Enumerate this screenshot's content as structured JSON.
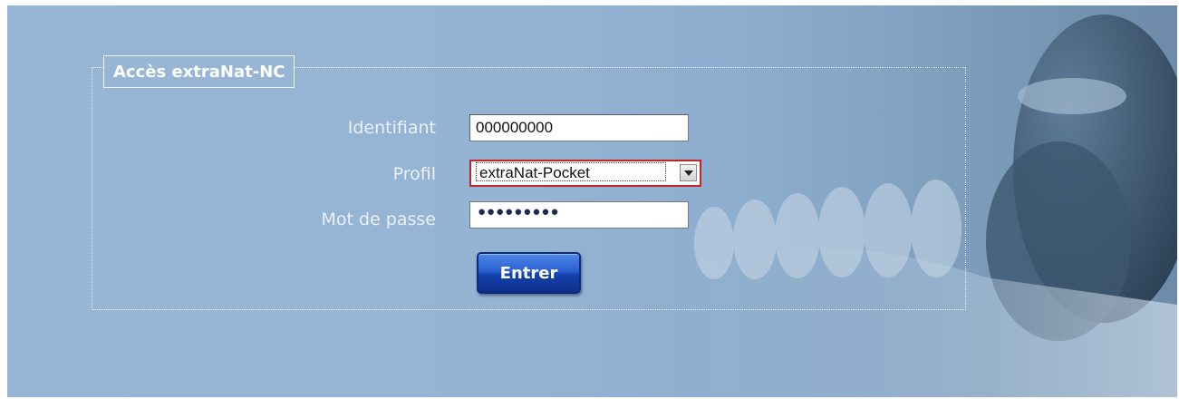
{
  "login": {
    "legend": "Accès extraNat-NC",
    "identifiant_label": "Identifiant",
    "identifiant_value": "000000000",
    "profil_label": "Profil",
    "profil_selected": "extraNat-Pocket",
    "password_label": "Mot de passe",
    "password_mask": "●●●●●●●●●",
    "submit_label": "Entrer"
  },
  "colors": {
    "background": "#97b5d5",
    "button": "#1442ad",
    "select_focus_border": "#c0272d"
  },
  "icons": {
    "dropdown": "chevron-down-icon",
    "background_photo": "swimmer-photo"
  }
}
